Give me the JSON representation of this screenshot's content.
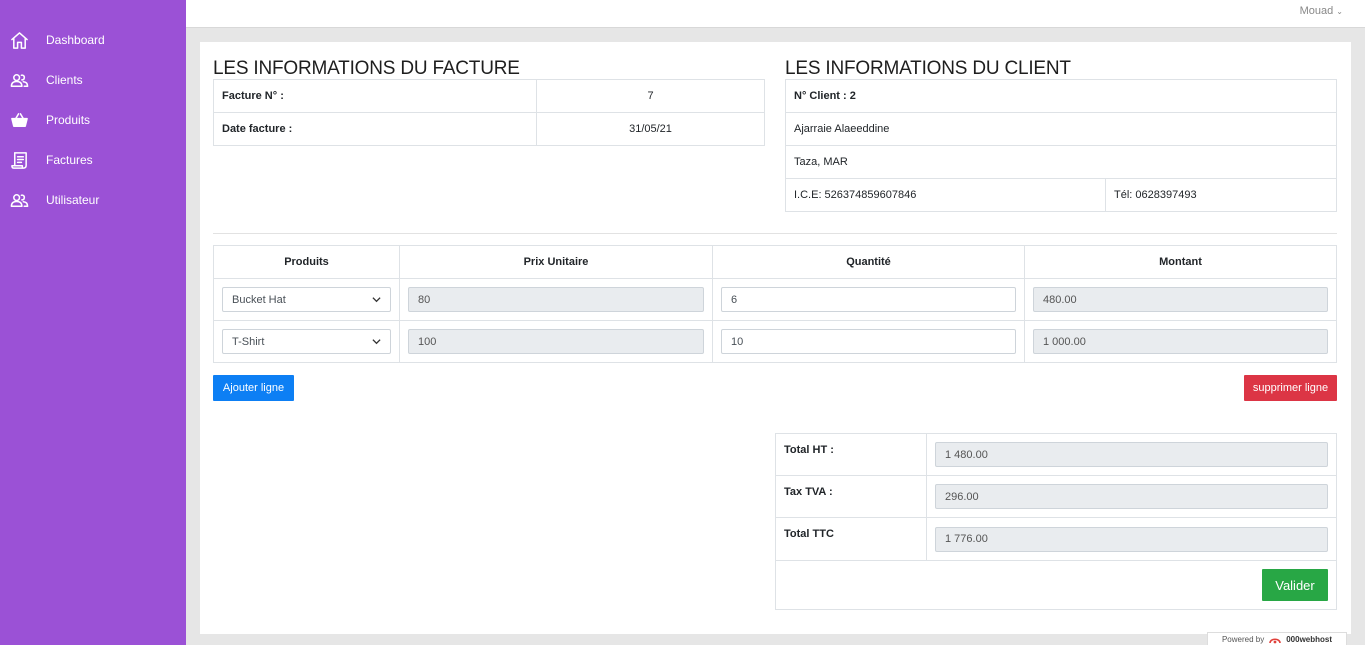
{
  "sidebar": {
    "items": [
      {
        "label": "Dashboard",
        "icon": "home-icon"
      },
      {
        "label": "Clients",
        "icon": "users-icon"
      },
      {
        "label": "Produits",
        "icon": "basket-icon"
      },
      {
        "label": "Factures",
        "icon": "invoice-icon"
      },
      {
        "label": "Utilisateur",
        "icon": "users-icon"
      }
    ],
    "color": "#9b51d6"
  },
  "topbar": {
    "user": "Mouad"
  },
  "invoice": {
    "heading": "LES INFORMATIONS DU FACTURE",
    "number_label": "Facture N° :",
    "number": "7",
    "date_label": "Date facture :",
    "date": "31/05/21"
  },
  "client": {
    "heading": "LES INFORMATIONS DU CLIENT",
    "number": "N° Client : 2",
    "name": "Ajarraie Alaeeddine",
    "city": "Taza, MAR",
    "ice": "I.C.E: 526374859607846",
    "phone": "Tél: 0628397493"
  },
  "lines": {
    "headers": [
      "Produits",
      "Prix Unitaire",
      "Quantité",
      "Montant"
    ],
    "rows": [
      {
        "product": "Bucket Hat",
        "price": "80",
        "quantity": "6",
        "amount": "480.00"
      },
      {
        "product": "T-Shirt",
        "price": "100",
        "quantity": "10",
        "amount": "1 000.00"
      }
    ]
  },
  "buttons": {
    "add_line": "Ajouter ligne",
    "delete_line": "supprimer ligne",
    "validate": "Valider"
  },
  "totals": {
    "ht_label": "Total HT :",
    "ht": "1 480.00",
    "tva_label": "Tax TVA :",
    "tva": "296.00",
    "ttc_label": "Total TTC",
    "ttc": "1 776.00"
  },
  "footer": {
    "powered_by": "Powered by",
    "host": "000webhost"
  },
  "colors": {
    "primary": "#0d7ff4",
    "danger": "#dc3545",
    "success": "#28a745"
  }
}
